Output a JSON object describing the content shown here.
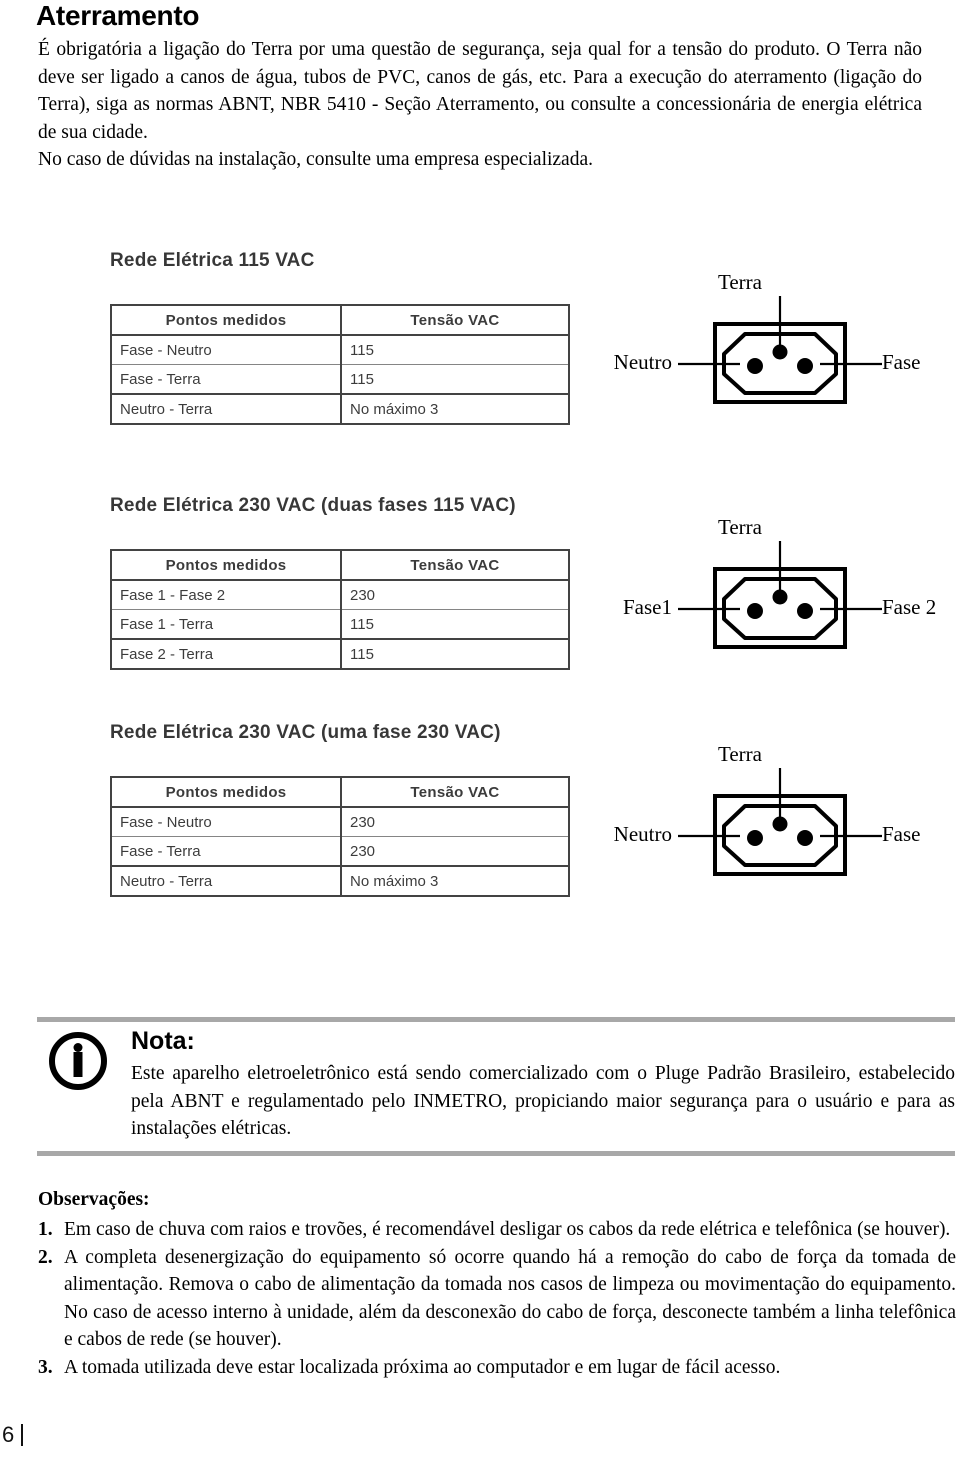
{
  "page": {
    "title": "Aterramento",
    "number": "6",
    "intro_paragraphs": [
      "É obrigatória a ligação do Terra por uma questão de segurança, seja qual for a tensão do produto. O Terra não deve ser ligado a canos de água, tubos de PVC, canos de gás, etc. Para a execução do aterramento (ligação do Terra), siga as normas ABNT, NBR 5410 - Seção Aterramento, ou consulte a concessionária de energia elétrica de sua cidade.",
      "No caso de dúvidas na instalação, consulte uma empresa especializada."
    ]
  },
  "networks": [
    {
      "heading": "Rede Elétrica 115 VAC",
      "table": {
        "columns": [
          "Pontos medidos",
          "Tensão VAC"
        ],
        "rows": [
          [
            "Fase - Neutro",
            "115"
          ],
          [
            "Fase - Terra",
            "115"
          ],
          [
            "Neutro - Terra",
            "No máximo 3"
          ]
        ]
      },
      "socket": {
        "top_label": "Terra",
        "left_label": "Neutro",
        "right_label": "Fase"
      }
    },
    {
      "heading": "Rede Elétrica 230 VAC (duas fases 115 VAC)",
      "table": {
        "columns": [
          "Pontos medidos",
          "Tensão VAC"
        ],
        "rows": [
          [
            "Fase 1 - Fase 2",
            "230"
          ],
          [
            "Fase 1 - Terra",
            "115"
          ],
          [
            "Fase 2 - Terra",
            "115"
          ]
        ]
      },
      "socket": {
        "top_label": "Terra",
        "left_label": "Fase1",
        "right_label": "Fase 2"
      }
    },
    {
      "heading": "Rede Elétrica 230 VAC (uma fase 230 VAC)",
      "table": {
        "columns": [
          "Pontos medidos",
          "Tensão VAC"
        ],
        "rows": [
          [
            "Fase - Neutro",
            "230"
          ],
          [
            "Fase - Terra",
            "230"
          ],
          [
            "Neutro - Terra",
            "No máximo 3"
          ]
        ]
      },
      "socket": {
        "top_label": "Terra",
        "left_label": "Neutro",
        "right_label": "Fase"
      }
    }
  ],
  "note": {
    "icon": "info-icon",
    "title": "Nota:",
    "body": "Este aparelho eletroeletrônico está sendo comercializado com o Pluge Padrão Brasileiro, estabelecido pela ABNT e regulamentado pelo INMETRO, propiciando maior segurança para o usuário e para as instalações elétricas."
  },
  "observations": {
    "title": "Observações:",
    "items": [
      {
        "num": "1.",
        "text": "Em caso de chuva com raios e trovões, é recomendável desligar os cabos da rede elétrica e telefônica (se houver)."
      },
      {
        "num": "2.",
        "text": "A completa desenergização do equipamento só ocorre quando há a remoção do cabo de força da tomada de alimentação. Remova o cabo de alimentação da tomada nos casos de limpeza ou movimentação do equipamento. No caso de acesso interno à unidade, além da desconexão do cabo de força, desconecte também a linha telefônica e cabos de rede (se houver)."
      },
      {
        "num": "3.",
        "text": "A tomada utilizada deve estar localizada próxima ao computador e em lugar de fácil acesso."
      }
    ]
  },
  "colors": {
    "text": "#000000",
    "rule": "#a8a8a8",
    "table_border": "#1a1a1a"
  }
}
